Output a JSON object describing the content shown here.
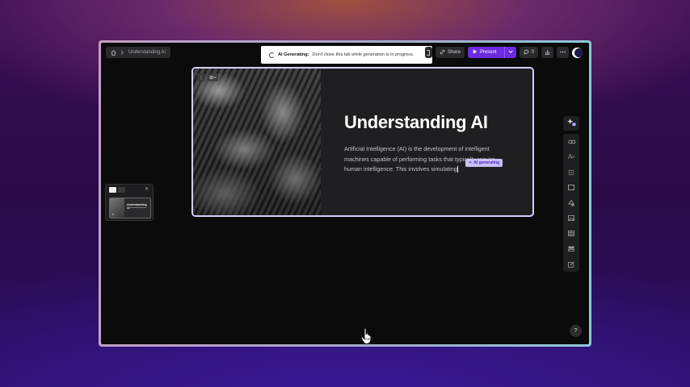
{
  "breadcrumb": {
    "page": "Understanding AI"
  },
  "toast": {
    "bold": "AI Generating:",
    "message": "Don't close this tab while generation is in progress."
  },
  "toolbar": {
    "share_label": "Share",
    "present_label": "Present",
    "comments_count": "0"
  },
  "slide": {
    "title": "Understanding AI",
    "body": "Artificial Intelligence (AI) is the development of intelligent machines capable of performing tasks that typically require human intelligence. This involves simulating",
    "ai_badge": "AI generating"
  },
  "thumbnail": {
    "number": "1",
    "title": "Understanding AI"
  },
  "help": {
    "label": "?"
  },
  "colors": {
    "accent": "#6b2be0",
    "badge": "#c8bff8",
    "selection_border": "#d4cfff"
  }
}
